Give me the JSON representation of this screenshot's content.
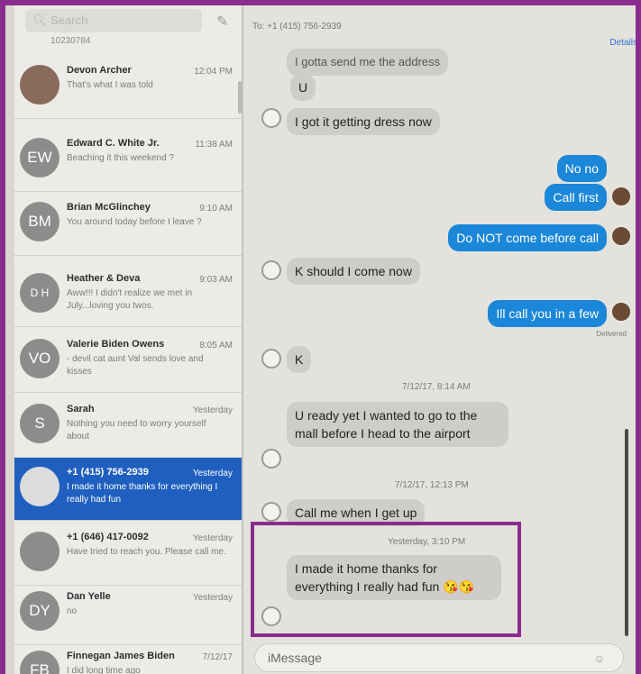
{
  "sidebar": {
    "search_placeholder": "Search",
    "top_partial": "10230784",
    "conversations": [
      {
        "name": "Devon Archer",
        "time": "12:04 PM",
        "preview": "That's what I was told",
        "avatar": "",
        "photo": true
      },
      {
        "name": "Edward C. White Jr.",
        "time": "11:38 AM",
        "preview": "Beaching it this weekend ?",
        "avatar": "EW"
      },
      {
        "name": "Brian McGlinchey",
        "time": "9:10 AM",
        "preview": "You around today before I leave ?",
        "avatar": "BM"
      },
      {
        "name": "Heather & Deva",
        "time": "9:03 AM",
        "preview": "Aww!!! I didn't realize we met in July...loving you twos.",
        "avatar": "D H"
      },
      {
        "name": "Valerie Biden Owens",
        "time": "8:05 AM",
        "preview": "- devil cat aunt Val sends love and kisses",
        "avatar": "VO"
      },
      {
        "name": "Sarah",
        "time": "Yesterday",
        "preview": "Nothing you need to worry yourself about",
        "avatar": "S"
      },
      {
        "name": "+1 (415) 756-2939",
        "time": "Yesterday",
        "preview": "I made it home thanks for everything I really had fun",
        "avatar": "",
        "selected": true
      },
      {
        "name": "+1 (646) 417-0092",
        "time": "Yesterday",
        "preview": "Have tried to reach you. Please call me.",
        "avatar": ""
      },
      {
        "name": "Dan Yelle",
        "time": "Yesterday",
        "preview": "no",
        "avatar": "DY"
      },
      {
        "name": "Finnegan James Biden",
        "time": "7/12/17",
        "preview": "I did long time ago",
        "avatar": "FB"
      }
    ]
  },
  "chat": {
    "to_label": "To: +1 (415) 756-2939",
    "details": "Details",
    "partial_top": "I gotta send me the address",
    "messages": [
      {
        "dir": "in",
        "text": "U"
      },
      {
        "dir": "in",
        "text": "I got it getting dress now"
      },
      {
        "dir": "out",
        "text": "No no"
      },
      {
        "dir": "out",
        "text": "Call first"
      },
      {
        "dir": "out",
        "text": "Do NOT come before call"
      },
      {
        "dir": "in",
        "text": "K should I come now"
      },
      {
        "dir": "out",
        "text": "Ill call you in a few"
      },
      {
        "dir": "in",
        "text": "K"
      },
      {
        "dir": "in",
        "text": "U ready yet I wanted to go to the mall before I head to the airport"
      },
      {
        "dir": "in",
        "text": "Call me when I get up"
      },
      {
        "dir": "in",
        "text": "I made it home thanks for everything I really had fun 😘😘"
      }
    ],
    "delivered": "Delivered",
    "stamp1": "7/12/17, 8:14 AM",
    "stamp2": "7/12/17, 12:13 PM",
    "stamp3": "Yesterday, 3:10 PM",
    "input_placeholder": "iMessage"
  },
  "colors": {
    "frame": "#8a2c8e",
    "selected": "#1f5fbf",
    "outgoing": "#1b87d8",
    "incoming": "#cfcdc9"
  }
}
